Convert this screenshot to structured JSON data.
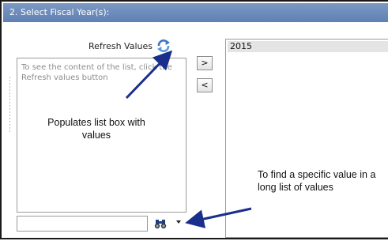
{
  "panel": {
    "title": "2. Select Fiscal Year(s):"
  },
  "refresh": {
    "label": "Refresh Values",
    "icon": "refresh-icon"
  },
  "left_list": {
    "hint": "To see the content of the list, click the Refresh values button"
  },
  "buttons": {
    "add": ">",
    "remove": "<"
  },
  "right_list": {
    "items": [
      "2015"
    ]
  },
  "search": {
    "value": "",
    "icon": "binoculars-icon",
    "dropdown_icon": "caret-down-icon"
  },
  "annotations": {
    "refresh_note": "Populates list box with values",
    "search_note": "To find a specific value in a long list of values"
  },
  "colors": {
    "title_bar": "#6d8cbd",
    "selected_item": "#e4e4e4",
    "arrow": "#1a2e8c"
  }
}
